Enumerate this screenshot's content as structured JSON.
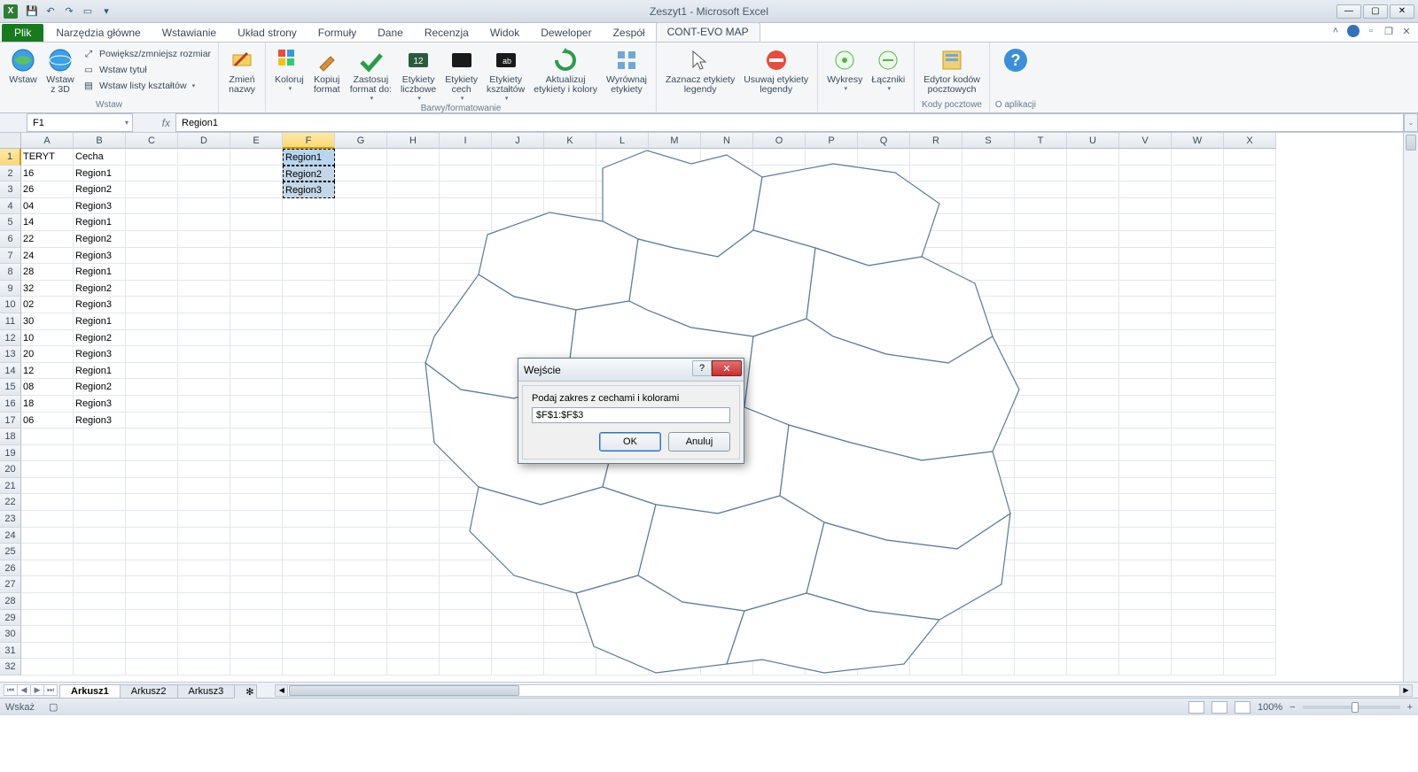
{
  "window": {
    "title": "Zeszyt1 - Microsoft Excel"
  },
  "ribbon": {
    "file": "Plik",
    "tabs": [
      "Narzędzia główne",
      "Wstawianie",
      "Układ strony",
      "Formuły",
      "Dane",
      "Recenzja",
      "Widok",
      "Deweloper",
      "Zespół",
      "CONT-EVO MAP"
    ],
    "active_tab": 9,
    "groups": {
      "wstaw": {
        "label": "Wstaw",
        "wstaw": "Wstaw",
        "wstaw3d": "Wstaw\nz 3D",
        "powieksz": "Powiększ/zmniejsz rozmiar",
        "wstaw_tytul": "Wstaw tytuł",
        "wstaw_listy": "Wstaw listy kształtów"
      },
      "zmien": "Zmień\nnazwy",
      "barwy": {
        "label": "Barwy/formatowanie",
        "koloruj": "Koloruj",
        "kopiuj": "Kopiuj\nformat",
        "zastosuj": "Zastosuj\nformat do:",
        "et_licz": "Etykiety\nliczbowe",
        "et_cech": "Etykiety\ncech",
        "et_kszt": "Etykiety\nkształtów",
        "aktualizuj": "Aktualizuj\netykiety i kolory",
        "wyrownaj": "Wyrównaj\netykiety"
      },
      "zaznacz": "Zaznacz etykiety\nlegendy",
      "usuwaj": "Usuwaj etykiety\nlegendy",
      "wykresy": "Wykresy",
      "laczniki": "Łączniki",
      "kody": {
        "label": "Kody pocztowe",
        "edytor": "Edytor kodów\npocztowych"
      },
      "app": {
        "label": "O aplikacji"
      }
    }
  },
  "namebox": "F1",
  "formula": "Region1",
  "columns": [
    "A",
    "B",
    "C",
    "D",
    "E",
    "F",
    "G",
    "H",
    "I",
    "J",
    "K",
    "L",
    "M",
    "N",
    "O",
    "P",
    "Q",
    "R",
    "S",
    "T",
    "U",
    "V",
    "W",
    "X"
  ],
  "sel_col_idx": 5,
  "sel_row_idx": 0,
  "row_count": 32,
  "gridA": [
    "TERYT",
    "16",
    "26",
    "04",
    "14",
    "22",
    "24",
    "28",
    "32",
    "02",
    "30",
    "10",
    "20",
    "12",
    "08",
    "18",
    "06"
  ],
  "gridB": [
    "Cecha",
    "Region1",
    "Region2",
    "Region3",
    "Region1",
    "Region2",
    "Region3",
    "Region1",
    "Region2",
    "Region3",
    "Region1",
    "Region2",
    "Region3",
    "Region1",
    "Region2",
    "Region3",
    "Region3"
  ],
  "gridF": [
    "Region1",
    "Region2",
    "Region3"
  ],
  "dialog": {
    "title": "Wejście",
    "label": "Podaj zakres z cechami i kolorami",
    "value": "$F$1:$F$3",
    "ok": "OK",
    "cancel": "Anuluj"
  },
  "sheets": {
    "tabs": [
      "Arkusz1",
      "Arkusz2",
      "Arkusz3"
    ],
    "active": 0
  },
  "status": {
    "mode": "Wskaż",
    "zoom": "100%"
  }
}
